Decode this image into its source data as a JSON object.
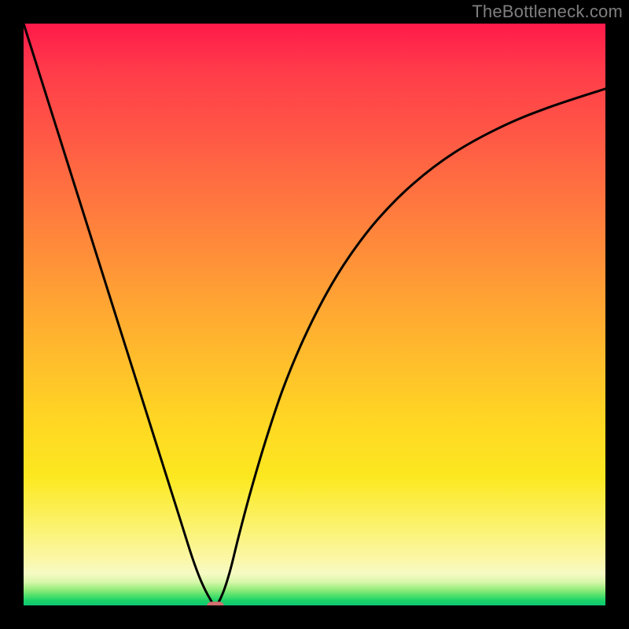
{
  "watermark": "TheBottleneck.com",
  "chart_data": {
    "type": "line",
    "title": "",
    "xlabel": "",
    "ylabel": "",
    "xlim": [
      0,
      1
    ],
    "ylim": [
      0,
      1
    ],
    "min_point": {
      "x": 0.33,
      "y": 0.0
    },
    "series": [
      {
        "name": "bottleneck-curve",
        "x": [
          0.0,
          0.03,
          0.06,
          0.09,
          0.12,
          0.15,
          0.18,
          0.21,
          0.24,
          0.27,
          0.29,
          0.305,
          0.32,
          0.33,
          0.342,
          0.355,
          0.37,
          0.39,
          0.415,
          0.445,
          0.48,
          0.52,
          0.56,
          0.61,
          0.67,
          0.74,
          0.82,
          0.9,
          1.0
        ],
        "y": [
          1.0,
          0.905,
          0.81,
          0.715,
          0.62,
          0.525,
          0.43,
          0.335,
          0.24,
          0.145,
          0.082,
          0.042,
          0.012,
          0.0,
          0.02,
          0.06,
          0.12,
          0.195,
          0.28,
          0.37,
          0.455,
          0.535,
          0.6,
          0.665,
          0.725,
          0.778,
          0.822,
          0.855,
          0.888
        ],
        "color": "#000000"
      }
    ]
  }
}
